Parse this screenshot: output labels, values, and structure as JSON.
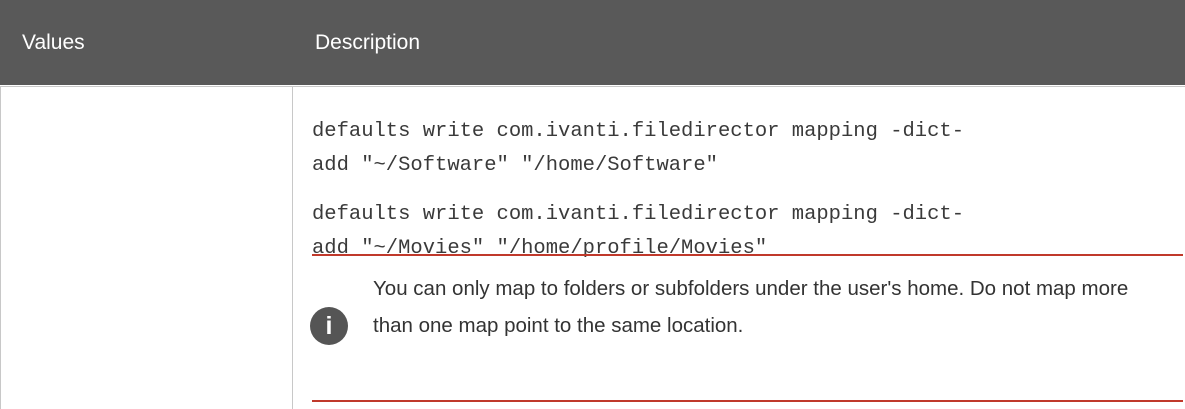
{
  "table": {
    "headers": {
      "values": "Values",
      "description": "Description"
    },
    "row": {
      "value": "",
      "code_lines": [
        "defaults write com.ivanti.filedirector mapping -dict-\nadd \"~/Software\" \"/home/Software\"",
        "defaults write com.ivanti.filedirector mapping -dict-\nadd \"~/Movies\" \"/home/profile/Movies\""
      ],
      "note": {
        "icon": "info-icon",
        "icon_glyph": "i",
        "text": "You can only map to folders or subfolders under the user's home. Do not map more than one map point to the same location.",
        "rule_color": "#c0392b"
      }
    }
  },
  "colors": {
    "header_bg": "#595959",
    "header_text": "#ffffff",
    "border": "#c8c8c8",
    "icon_bg": "#555555"
  }
}
